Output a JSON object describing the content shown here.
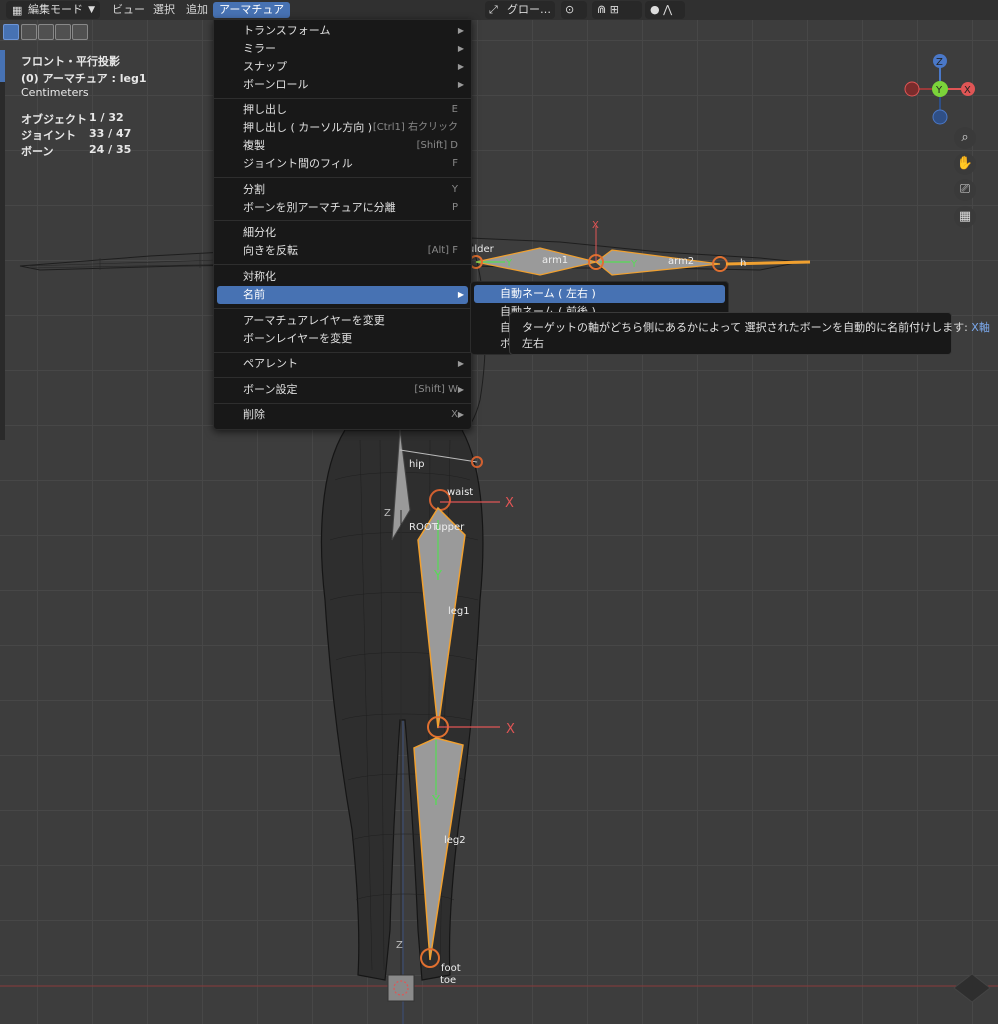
{
  "header": {
    "mode_label": "編集モード",
    "menus": [
      "ビュー",
      "選択",
      "追加",
      "アーマチュア"
    ],
    "transform_orientation": "グロー…"
  },
  "overlay": {
    "view_name": "フロント・平行投影",
    "active_object": "(0) アーマチュア : leg1",
    "units": "Centimeters",
    "stats": [
      {
        "label": "オブジェクト",
        "value": "1 / 32"
      },
      {
        "label": "ジョイント",
        "value": "33 / 47"
      },
      {
        "label": "ボーン",
        "value": "24 / 35"
      }
    ]
  },
  "armature_menu": {
    "items": [
      {
        "label": "トランスフォーム",
        "shortcut": "",
        "submenu": true
      },
      {
        "label": "ミラー",
        "shortcut": "",
        "submenu": true
      },
      {
        "label": "スナップ",
        "shortcut": "",
        "submenu": true
      },
      {
        "label": "ボーンロール",
        "shortcut": "",
        "submenu": true
      },
      {
        "label": "押し出し",
        "shortcut": "E",
        "submenu": false
      },
      {
        "label": "押し出し ( カーソル方向 )",
        "shortcut": "[Ctrl1] 右クリック",
        "submenu": false
      },
      {
        "label": "複製",
        "shortcut": "[Shift] D",
        "submenu": false
      },
      {
        "label": "ジョイント間のフィル",
        "shortcut": "F",
        "submenu": false
      },
      {
        "label": "分割",
        "shortcut": "Y",
        "submenu": false
      },
      {
        "label": "ボーンを別アーマチュアに分離",
        "shortcut": "P",
        "submenu": false
      },
      {
        "label": "細分化",
        "shortcut": "",
        "submenu": false
      },
      {
        "label": "向きを反転",
        "shortcut": "[Alt] F",
        "submenu": false
      },
      {
        "label": "対称化",
        "shortcut": "",
        "submenu": false
      },
      {
        "label": "名前",
        "shortcut": "",
        "submenu": true
      },
      {
        "label": "アーマチュアレイヤーを変更",
        "shortcut": "",
        "submenu": false
      },
      {
        "label": "ボーンレイヤーを変更",
        "shortcut": "",
        "submenu": false
      },
      {
        "label": "ペアレント",
        "shortcut": "",
        "submenu": true
      },
      {
        "label": "ボーン設定",
        "shortcut": "[Shift] W",
        "submenu": true
      },
      {
        "label": "削除",
        "shortcut": "X",
        "submenu": true
      }
    ]
  },
  "name_submenu": {
    "items": [
      "自動ネーム ( 左右 )",
      "自動ネーム ( 前後 )",
      "自",
      "ボ"
    ]
  },
  "tooltip": {
    "text": "ターゲットの軸がどちら側にあるかによって 選択されたボーンを自動的に名前付けします:",
    "highlight": "X軸",
    "line2": "左右"
  },
  "gizmo": {
    "x": "X",
    "y": "Y",
    "z": "Z"
  },
  "bones": {
    "hip": "hip",
    "waist": "waist",
    "upper": "upper",
    "root": "ROOT",
    "leg1": "leg1",
    "leg2": "leg2",
    "foot": "foot",
    "toe": "toe",
    "arm1": "arm1",
    "arm2": "arm2",
    "shoulder": "ulder",
    "hand": "h",
    "axis_x": "X",
    "axis_y": "Y",
    "axis_z": "Z"
  },
  "colors": {
    "accent": "#4772b3",
    "bone_select": "#f0a030",
    "axis_x": "#e05555",
    "axis_y": "#55dd55",
    "axis_z": "#4a78c8"
  }
}
